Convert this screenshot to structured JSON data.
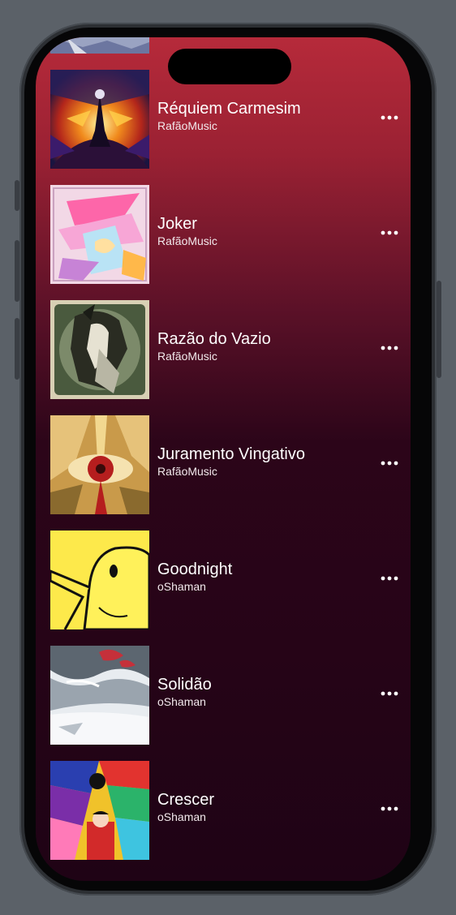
{
  "songs": [
    {
      "title": "Réquiem Carmesim",
      "artist": "RafãoMusic",
      "cover_icon": "requiem-cover-art"
    },
    {
      "title": "Joker",
      "artist": "RafãoMusic",
      "cover_icon": "joker-cover-art"
    },
    {
      "title": "Razão do Vazio",
      "artist": "RafãoMusic",
      "cover_icon": "razao-cover-art"
    },
    {
      "title": "Juramento Vingativo",
      "artist": "RafãoMusic",
      "cover_icon": "juramento-cover-art"
    },
    {
      "title": "Goodnight",
      "artist": "oShaman",
      "cover_icon": "goodnight-bird-cover-art"
    },
    {
      "title": "Solidão",
      "artist": "oShaman",
      "cover_icon": "solidao-cover-art"
    },
    {
      "title": "Crescer",
      "artist": "oShaman",
      "cover_icon": "crescer-cover-art"
    }
  ],
  "more_icon": "ellipsis-icon",
  "colors": {
    "background_top": "#b62a3a",
    "background_bottom": "#1f0315",
    "text": "#ffffff"
  }
}
